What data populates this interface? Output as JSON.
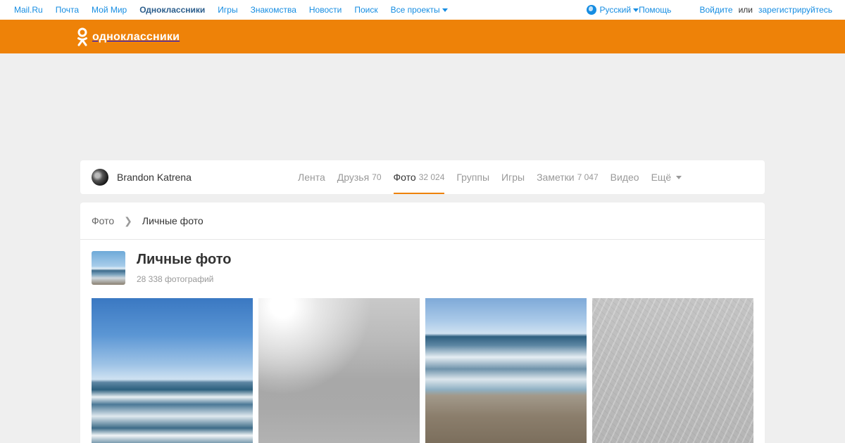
{
  "portal": {
    "links": [
      "Mail.Ru",
      "Почта",
      "Мой Мир",
      "Одноклассники",
      "Игры",
      "Знакомства",
      "Новости",
      "Поиск"
    ],
    "all_projects": "Все проекты",
    "language": "Русский",
    "help": "Помощь",
    "login": "Войдите",
    "or": "или",
    "register": "зарегистрируйтесь"
  },
  "header": {
    "logo_text": "одноклассники",
    "background": "#ee8208"
  },
  "profile": {
    "name": "Brandon Katrena",
    "nav": [
      {
        "label": "Лента",
        "count": ""
      },
      {
        "label": "Друзья",
        "count": "70"
      },
      {
        "label": "Фото",
        "count": "32 024"
      },
      {
        "label": "Группы",
        "count": ""
      },
      {
        "label": "Игры",
        "count": ""
      },
      {
        "label": "Заметки",
        "count": "7 047"
      },
      {
        "label": "Видео",
        "count": ""
      },
      {
        "label": "Ещё",
        "count": ""
      }
    ],
    "active_tab": "Фото"
  },
  "breadcrumb": {
    "root": "Фото",
    "separator": "❯",
    "current": "Личные фото"
  },
  "album": {
    "title": "Личные фото",
    "count": "28 338 фотографий"
  },
  "colors": {
    "accent": "#ee8208",
    "link": "#168de2"
  }
}
